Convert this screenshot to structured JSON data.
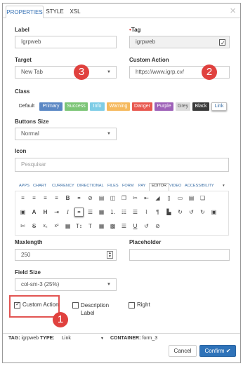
{
  "tabs": [
    "PROPERTIES",
    "STYLE",
    "XSL"
  ],
  "close_glyph": "×",
  "label": {
    "title": "Label",
    "value": "Igrpweb"
  },
  "tag": {
    "required_mark": "•",
    "title": "Tag",
    "value": "igrpweb"
  },
  "target": {
    "title": "Target",
    "value": "New Tab"
  },
  "custom_action": {
    "title": "Custom Action",
    "value": "https://www.igrp.cv/"
  },
  "class": {
    "title": "Class",
    "options": [
      {
        "label": "Default",
        "color": "#ffffff"
      },
      {
        "label": "Primary",
        "color": "#5a87c4"
      },
      {
        "label": "Success",
        "color": "#7cc576"
      },
      {
        "label": "Info",
        "color": "#7fcde6"
      },
      {
        "label": "Warning",
        "color": "#f5b95d"
      },
      {
        "label": "Danger",
        "color": "#e8584f"
      },
      {
        "label": "Purple",
        "color": "#9e61b8"
      },
      {
        "label": "Grey",
        "color": "#dcdcdc"
      },
      {
        "label": "Black",
        "color": "#3a3a3a"
      },
      {
        "label": "Link",
        "color": "#ffffff"
      }
    ]
  },
  "buttons_size": {
    "title": "Buttons Size",
    "value": "Normal"
  },
  "icon": {
    "title": "Icon",
    "placeholder": "Pesquisar"
  },
  "editor_tabs": [
    "APPS",
    "CHART",
    "CURRENCY",
    "DIRECTIONAL",
    "FILES",
    "FORM",
    "PAY",
    "EDITOR",
    "VIDEO",
    "ACCESSIBILITY"
  ],
  "editor_caret": "▾",
  "maxlength": {
    "title": "Maxlength",
    "value": "250"
  },
  "placeholder_field": {
    "title": "Placeholder",
    "value": ""
  },
  "field_size": {
    "title": "Field Size",
    "value": "col-sm-3 (25%)"
  },
  "checkboxes": [
    {
      "label": "Custom Action",
      "checked": true
    },
    {
      "label": "Description",
      "label2": "Label",
      "checked": false
    },
    {
      "label": "Right",
      "checked": false
    }
  ],
  "footer": {
    "tag_label": "TAG:",
    "tag_value": "igrpweb",
    "type_label": "TYPE:",
    "type_value": "Link",
    "container_label": "CONTAINER:",
    "container_value": "form_3",
    "cancel": "Cancel",
    "confirm": "Confirm"
  },
  "callouts": [
    "1",
    "2",
    "3"
  ],
  "colors": {
    "accent": "#2f73b9",
    "callout": "#e0413e",
    "highlight_border": "#e25452"
  }
}
